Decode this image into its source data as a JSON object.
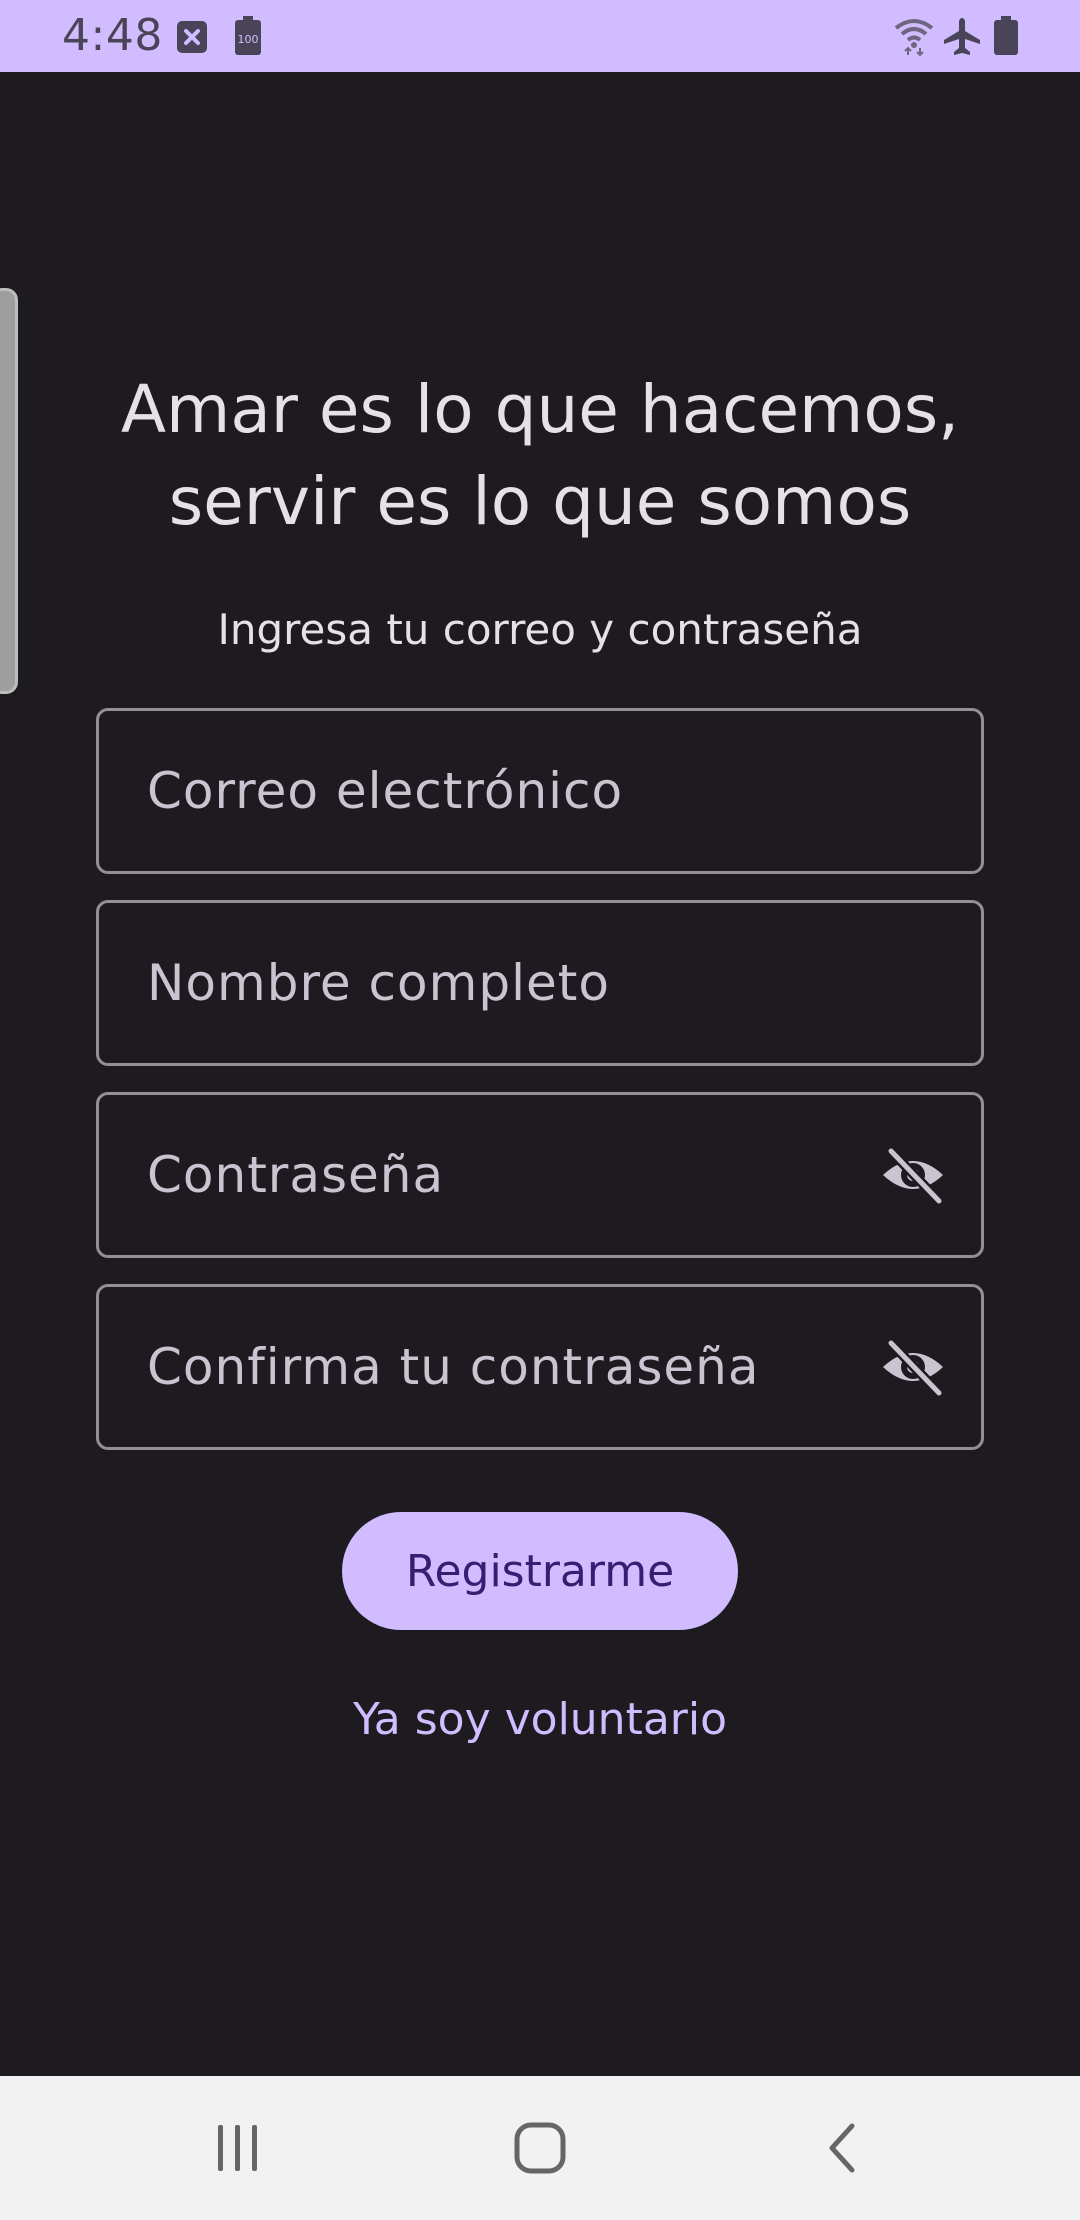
{
  "status_bar": {
    "time": "4:48",
    "icons": [
      "notification-blocked-icon",
      "battery-100-icon",
      "wifi-icon",
      "airplane-mode-icon",
      "battery-icon"
    ]
  },
  "content": {
    "headline": "Amar es lo que hacemos, servir es lo que somos",
    "subtitle": "Ingresa tu correo y contraseña"
  },
  "form": {
    "email_placeholder": "Correo electrónico",
    "name_placeholder": "Nombre completo",
    "password_placeholder": "Contraseña",
    "confirm_password_placeholder": "Confirma tu contraseña"
  },
  "actions": {
    "register_label": "Registrarme",
    "login_link_label": "Ya soy voluntario"
  },
  "colors": {
    "background": "#1d1b20",
    "accent": "#d0bcff",
    "on_accent": "#381e72",
    "outline": "#938f99"
  },
  "navigation": {
    "buttons": [
      "recent-apps-icon",
      "home-icon",
      "back-icon"
    ]
  }
}
